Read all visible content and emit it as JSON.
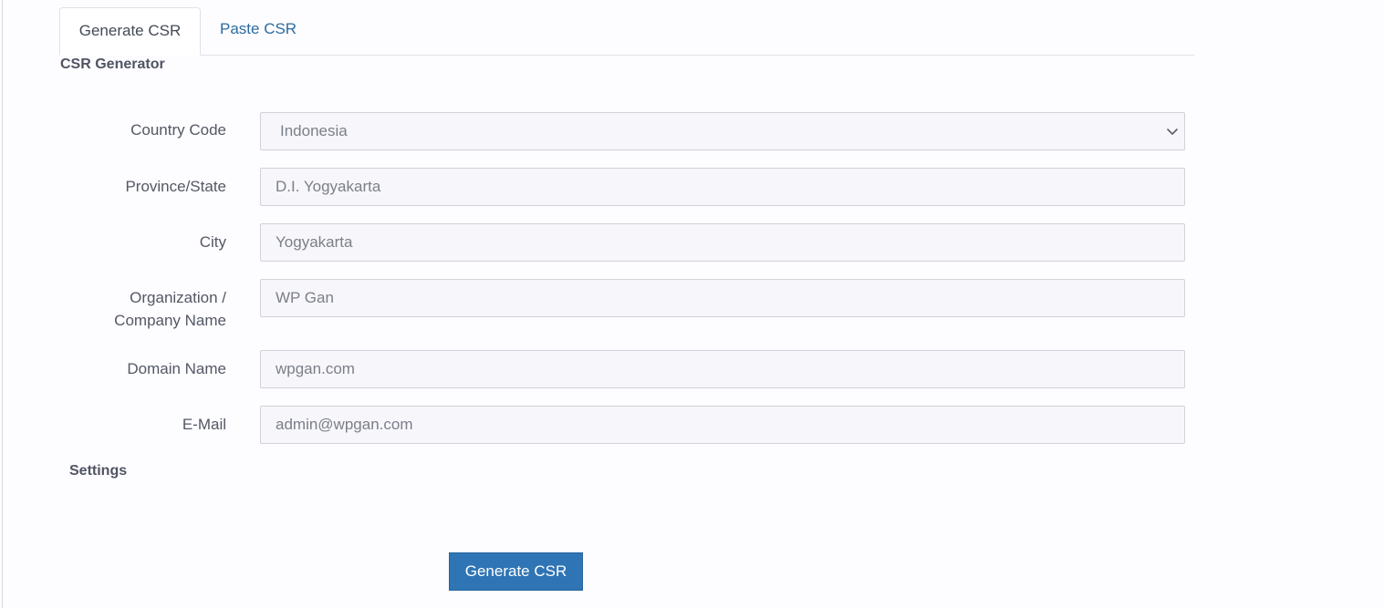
{
  "tabs": [
    {
      "label": "Generate CSR",
      "active": true
    },
    {
      "label": "Paste CSR",
      "active": false
    }
  ],
  "form": {
    "title": "CSR Generator",
    "fields": {
      "country": {
        "label": "Country Code",
        "value": "Indonesia"
      },
      "province": {
        "label": "Province/State",
        "value": "D.I. Yogyakarta"
      },
      "city": {
        "label": "City",
        "value": "Yogyakarta"
      },
      "organization": {
        "label_line1": "Organization /",
        "label_line2": "Company Name",
        "value": "WP Gan"
      },
      "domain": {
        "label": "Domain Name",
        "value": "wpgan.com"
      },
      "email": {
        "label": "E-Mail",
        "value": "admin@wpgan.com"
      }
    },
    "settings_title": "Settings",
    "submit_label": "Generate CSR"
  },
  "icons": {
    "select_arrow": "chevron-down-icon"
  },
  "colors": {
    "accent": "#2f75b5",
    "link": "#2c6ca0",
    "field_bg": "#f7f6fb"
  }
}
